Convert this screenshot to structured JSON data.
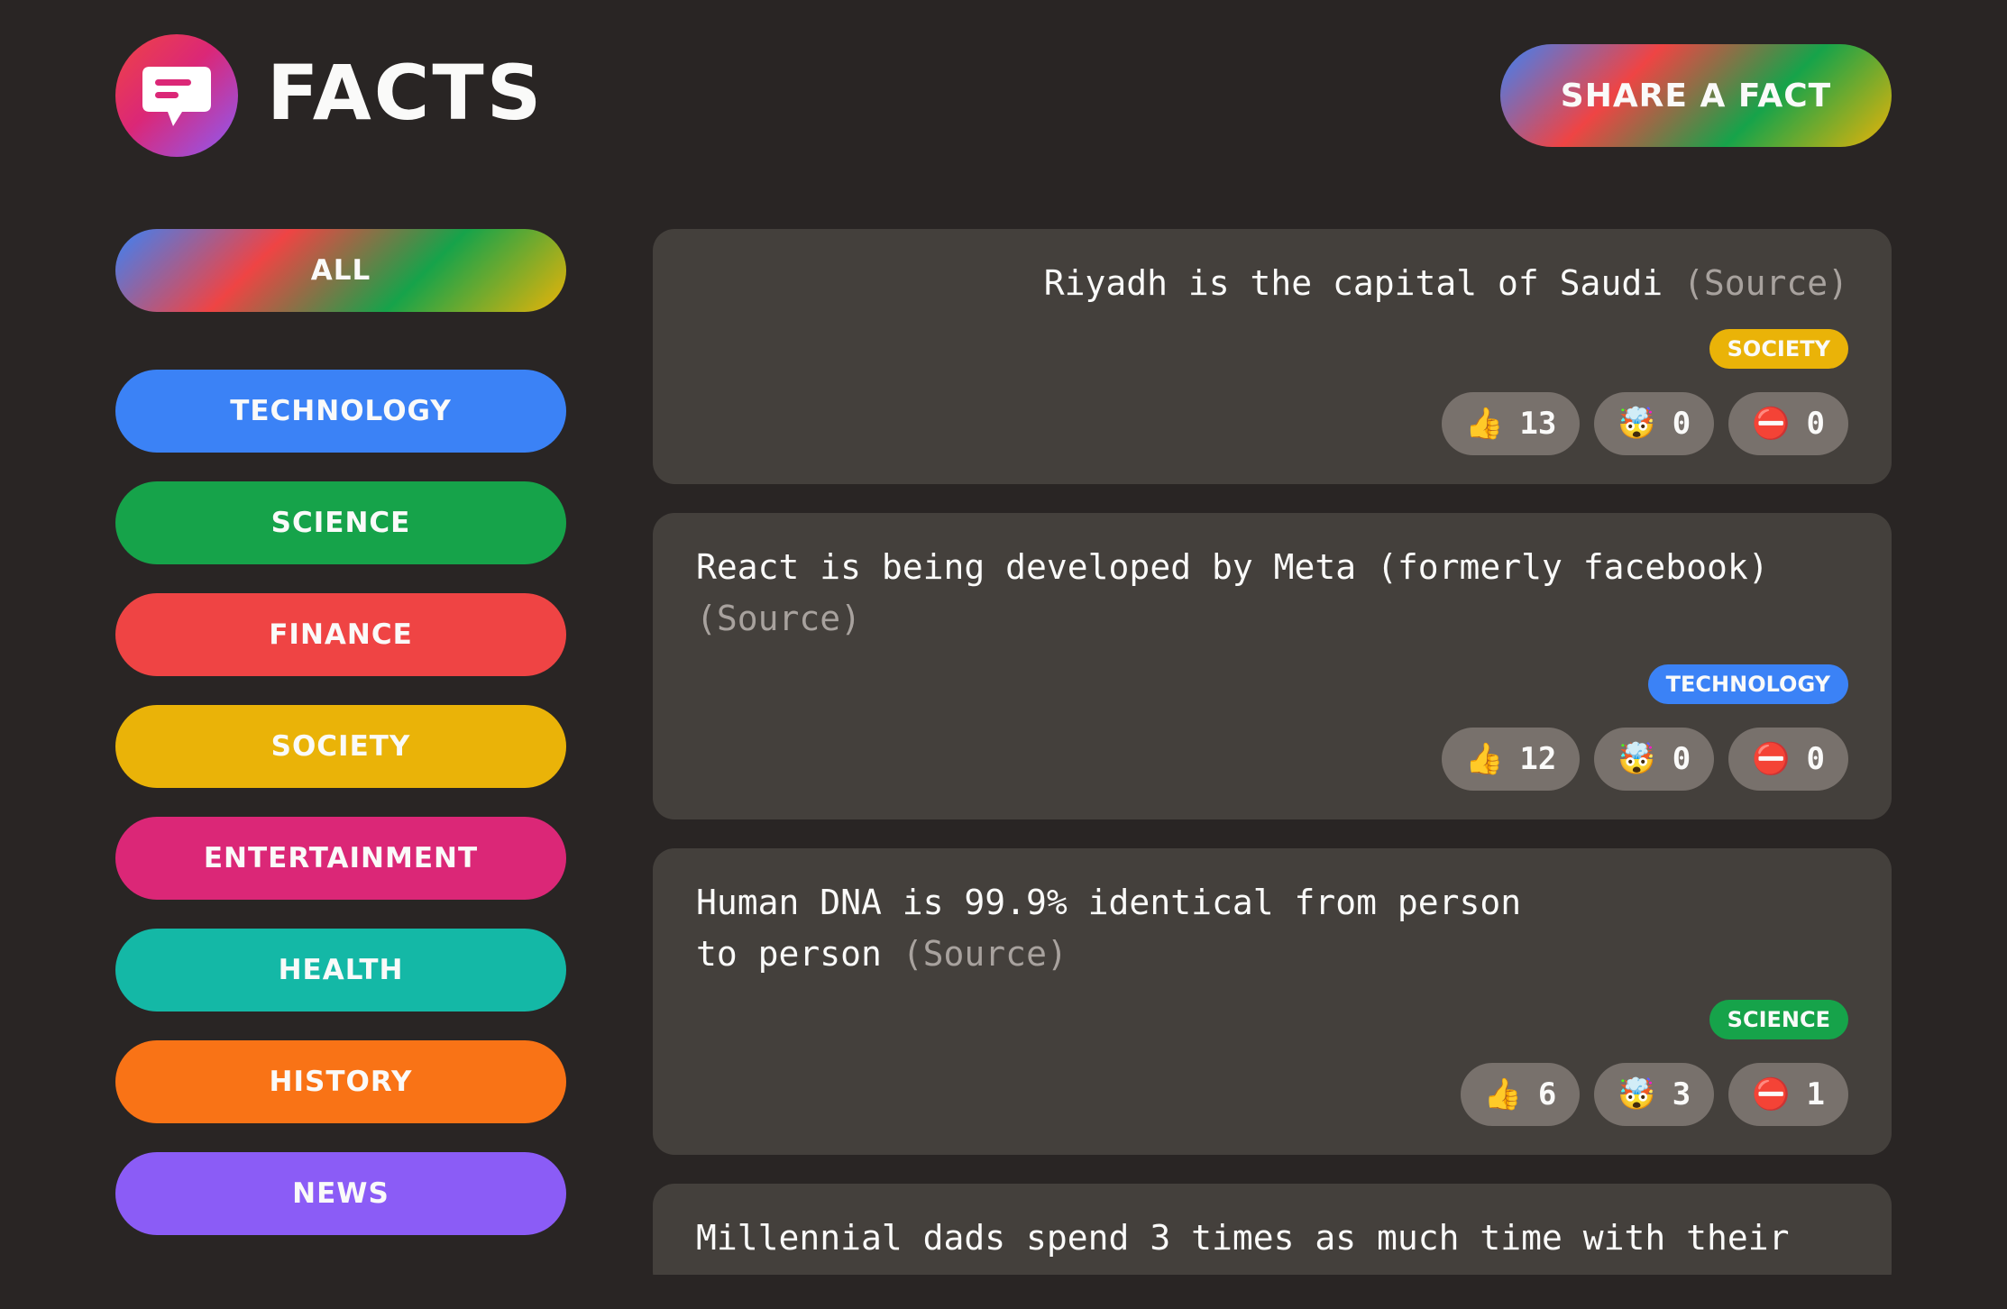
{
  "header": {
    "app_title": "FACTS",
    "share_label": "SHARE A FACT"
  },
  "sidebar": {
    "categories": [
      {
        "label": "ALL",
        "color": "gradient"
      },
      {
        "label": "TECHNOLOGY",
        "color": "#3b82f6"
      },
      {
        "label": "SCIENCE",
        "color": "#16a34a"
      },
      {
        "label": "FINANCE",
        "color": "#ef4444"
      },
      {
        "label": "SOCIETY",
        "color": "#eab308"
      },
      {
        "label": "ENTERTAINMENT",
        "color": "#db2777"
      },
      {
        "label": "HEALTH",
        "color": "#14b8a6"
      },
      {
        "label": "HISTORY",
        "color": "#f97316"
      },
      {
        "label": "NEWS",
        "color": "#8b5cf6"
      }
    ]
  },
  "facts": [
    {
      "text": "Riyadh is the capital of Saudi",
      "source_label": "(Source)",
      "category": "SOCIETY",
      "category_color": "#eab308",
      "votes": {
        "interesting": "13",
        "mindblowing": "0",
        "false": "0"
      }
    },
    {
      "text": "React is being developed by Meta (formerly facebook)",
      "source_label": "(Source)",
      "category": "TECHNOLOGY",
      "category_color": "#3b82f6",
      "votes": {
        "interesting": "12",
        "mindblowing": "0",
        "false": "0"
      }
    },
    {
      "text": "Human DNA is 99.9% identical from person to person",
      "source_label": "(Source)",
      "category": "SCIENCE",
      "category_color": "#16a34a",
      "votes": {
        "interesting": "6",
        "mindblowing": "3",
        "false": "1"
      }
    },
    {
      "text": "Millennial dads spend 3 times as much time with their"
    }
  ],
  "icons": {
    "logo": "speech-bubble-icon",
    "interesting": "thumbs-up-icon",
    "mindblowing": "exploding-head-icon",
    "false": "no-entry-icon"
  }
}
